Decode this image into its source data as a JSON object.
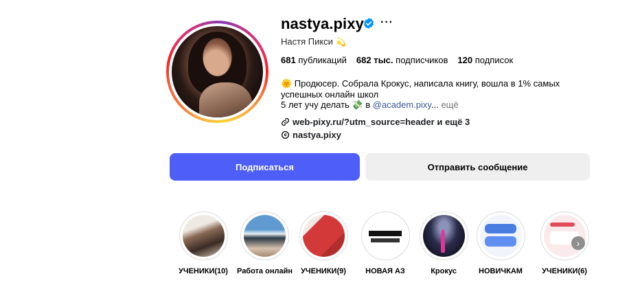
{
  "profile": {
    "username": "nastya.pixy",
    "full_name": "Настя Пикси",
    "full_name_emoji": "💫",
    "stats": {
      "posts_count": "681",
      "posts_label": "публикаций",
      "followers_count": "682 тыс.",
      "followers_label": "подписчиков",
      "following_count": "120",
      "following_label": "подписок"
    },
    "bio": {
      "line1": "🌞 Продюсер. Собрала Крокус, написала книгу, вошла в 1% самых успешных онлайн школ",
      "line2_prefix": "5 лет учу делать 💸 в ",
      "line2_link": "@academ.pixy",
      "line2_ellipsis": "...",
      "more": "ещё"
    },
    "website": "web-pixy.ru/?utm_source=header и ещё 3",
    "threads": "nastya.pixy"
  },
  "actions": {
    "follow_label": "Подписаться",
    "message_label": "Отправить сообщение"
  },
  "highlights": [
    {
      "label": "УЧЕНИКИ(10)",
      "colors": [
        "#e9e2dc",
        "#7a5a48",
        "#2d241f"
      ]
    },
    {
      "label": "Работа онлайн",
      "colors": [
        "#6da7d6",
        "#dfe9f1",
        "#c9b39e"
      ]
    },
    {
      "label": "УЧЕНИКИ(9)",
      "colors": [
        "#d33a3a",
        "#efe7e2",
        "#b22c2c"
      ]
    },
    {
      "label": "НОВАЯ АЗ",
      "colors": [
        "#111111",
        "#ffffff",
        "#222222"
      ]
    },
    {
      "label": "Крокус",
      "colors": [
        "#1a1930",
        "#4a4f73",
        "#e0359b"
      ]
    },
    {
      "label": "НОВИЧКАМ",
      "colors": [
        "#4a7de0",
        "#ffffff",
        "#f2f4fb"
      ]
    },
    {
      "label": "УЧЕНИКИ(6)",
      "colors": [
        "#f4c9cf",
        "#e14b5a",
        "#ffffff"
      ]
    }
  ],
  "icons": {
    "verified": "verified-badge-icon",
    "more": "more-options-icon",
    "link": "link-icon",
    "threads": "threads-icon",
    "next": "chevron-right-icon"
  },
  "colors": {
    "follow_button": "#4e5ef8",
    "message_button": "#efefef",
    "verified": "#0095f6"
  }
}
